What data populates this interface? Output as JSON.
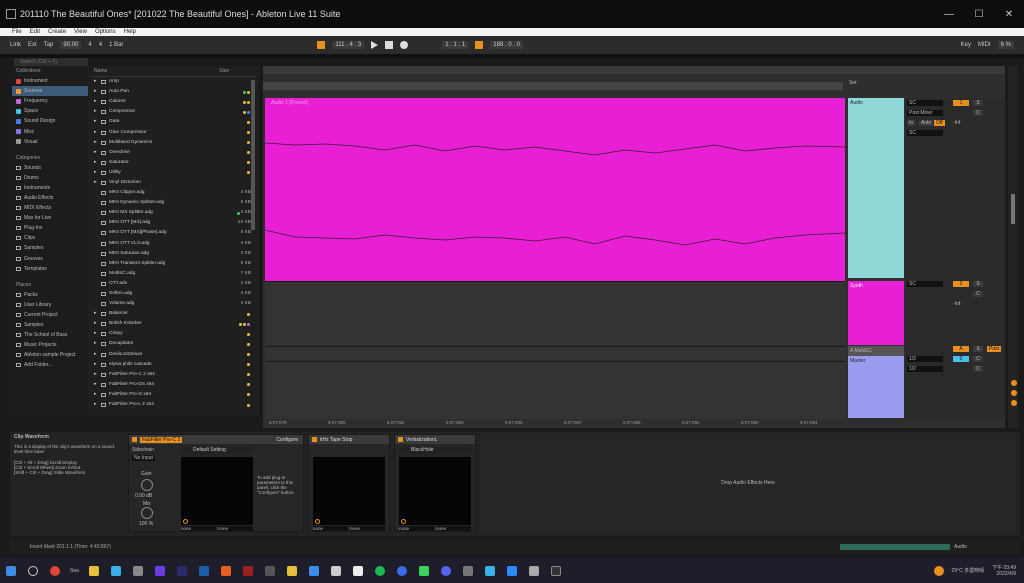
{
  "window": {
    "title": "201110 The Beautiful Ones* [201022 The Beautiful Ones] - Ableton Live 11 Suite",
    "controls": [
      "—",
      "☐",
      "✕"
    ]
  },
  "menu": [
    "File",
    "Edit",
    "Create",
    "View",
    "Options",
    "Help"
  ],
  "transport": {
    "link": "Link",
    "ext": "Ext",
    "tap": "Tap",
    "tempo": "90.00",
    "sig_num": "4",
    "sig_den": "4",
    "quant": "1 Bar",
    "position": "111 . 4 . 3",
    "loop_start": "1 . 1 . 1",
    "loop_len": "188 . 0 . 0",
    "key": "Key",
    "midi": "MIDI",
    "cpu": "6 %"
  },
  "browser": {
    "search_placeholder": "Search (Ctrl + F)",
    "collections_label": "Collections",
    "collections": [
      {
        "label": "Instrument",
        "color": "#e04444"
      },
      {
        "label": "Sources",
        "color": "#f29b2a"
      },
      {
        "label": "Frequency",
        "color": "#c764e0"
      },
      {
        "label": "Space",
        "color": "#46c0e8"
      },
      {
        "label": "Sound Design",
        "color": "#4a7be6"
      },
      {
        "label": "Misc",
        "color": "#8b6fe6"
      },
      {
        "label": "Visual",
        "color": "#999999"
      }
    ],
    "categories_label": "Categories",
    "categories": [
      "Sounds",
      "Drums",
      "Instruments",
      "Audio Effects",
      "MIDI Effects",
      "Max for Live",
      "Plug-Ins",
      "Clips",
      "Samples",
      "Grooves",
      "Templates"
    ],
    "places_label": "Places",
    "places": [
      "Packs",
      "User Library",
      "Current Project",
      "Samples",
      "The School of Bass",
      "Music Projects",
      "Ableton sample Project",
      "Add Folder..."
    ],
    "col_name": "Name",
    "col_size": "Size",
    "items": [
      {
        "name": "Amp",
        "size": "",
        "tags": []
      },
      {
        "name": "Auto Pan",
        "size": "",
        "tags": [
          "#3bd15a",
          "#e8c13a"
        ]
      },
      {
        "name": "Cabinet",
        "size": "",
        "tags": [
          "#e8c13a",
          "#e8c13a"
        ]
      },
      {
        "name": "Compressor",
        "size": "",
        "tags": [
          "#e8c13a",
          "#3b8de8"
        ]
      },
      {
        "name": "Gate",
        "size": "",
        "tags": [
          "#e8c13a"
        ]
      },
      {
        "name": "Glue Compressor",
        "size": "",
        "tags": [
          "#e8c13a"
        ]
      },
      {
        "name": "Multiband Dynamics",
        "size": "",
        "tags": [
          "#e8c13a"
        ]
      },
      {
        "name": "Overdrive",
        "size": "",
        "tags": [
          "#e8c13a"
        ]
      },
      {
        "name": "Saturator",
        "size": "",
        "tags": [
          "#e8c13a"
        ]
      },
      {
        "name": "Utility",
        "size": "",
        "tags": [
          "#e8c13a"
        ]
      },
      {
        "name": "Vinyl Distortion",
        "size": "",
        "tags": []
      },
      {
        "name": "MKII Clipper.adg",
        "size": "3 KB",
        "tags": []
      },
      {
        "name": "MKII Dynamic Splitter.adg",
        "size": "5 KB",
        "tags": []
      },
      {
        "name": "MKII MS Splitter.adg",
        "size": "3 KB",
        "tags": [
          "#3bd15a"
        ]
      },
      {
        "name": "MKII OTT [MS].adg",
        "size": "22 KB",
        "tags": []
      },
      {
        "name": "MKII OTT [MS][Phase].adg",
        "size": "6 KB",
        "tags": []
      },
      {
        "name": "MKII OTT v1.0.adg",
        "size": "4 KB",
        "tags": []
      },
      {
        "name": "MKII Saturator.adg",
        "size": "3 KB",
        "tags": []
      },
      {
        "name": "MKII Transient Splitter.adg",
        "size": "6 KB",
        "tags": []
      },
      {
        "name": "MultiSC.adg",
        "size": "7 KB",
        "tags": []
      },
      {
        "name": "OTT.adv",
        "size": "2 KB",
        "tags": []
      },
      {
        "name": "Soften.adg",
        "size": "4 KB",
        "tags": []
      },
      {
        "name": "Volume.adg",
        "size": "3 KB",
        "tags": []
      },
      {
        "name": "Balancer",
        "size": "",
        "tags": [
          "#e8c13a"
        ]
      },
      {
        "name": "British Kolorber",
        "size": "",
        "tags": [
          "#e8c13a",
          "#e8c13a",
          "#c764e0"
        ]
      },
      {
        "name": "Crispy",
        "size": "",
        "tags": [
          "#e8c13a"
        ]
      },
      {
        "name": "Decapitator",
        "size": "",
        "tags": [
          "#e8c13a"
        ]
      },
      {
        "name": "DevilLocDeluxe",
        "size": "",
        "tags": [
          "#e8c13a"
        ]
      },
      {
        "name": "elysia phils cascade",
        "size": "",
        "tags": [
          "#e8c13a"
        ]
      },
      {
        "name": "FabFilter Pro-C 2 x64",
        "size": "",
        "tags": [
          "#e8c13a"
        ]
      },
      {
        "name": "FabFilter Pro-DS x64",
        "size": "",
        "tags": [
          "#e8c13a"
        ]
      },
      {
        "name": "FabFilter Pro-G x64",
        "size": "",
        "tags": [
          "#e8c13a"
        ]
      },
      {
        "name": "FabFilter Pro-L 2 x64",
        "size": "",
        "tags": [
          "#e8c13a"
        ]
      }
    ]
  },
  "arrangement": {
    "clip_title": "Audio 1 [Frozen]",
    "set_label": "Set",
    "ruler": [
      "5:07:078",
      "5:07:080",
      "5:07:082",
      "5:07:083",
      "5:07:085",
      "5:07:087",
      "5:07:089",
      "5:07:090",
      "5:07:092",
      "5:07:094"
    ],
    "tracks": [
      {
        "name": "Audio",
        "color": "#8fd8d8",
        "in": "SC",
        "route": "Post Mixer",
        "auto": "In",
        "auto2": "Auto",
        "off": "Off",
        "num": "1",
        "S": "S",
        "C": "C",
        "inf": "-Inf"
      },
      {
        "name": "Synth",
        "color": "#e81fd4",
        "in": "SC",
        "num": "2",
        "S": "S",
        "C": "C",
        "inf": "-Inf"
      },
      {
        "name": "A MultiSC",
        "color": "#555555",
        "num": "A",
        "S": "S",
        "C": "C",
        "pre": "Post"
      },
      {
        "name": "Master",
        "color": "#9b9cf0",
        "r1": "1/2",
        "r2": "1/2",
        "num": "0",
        "C": "C"
      }
    ]
  },
  "clip_view": {
    "info_title": "Clip Waveform",
    "info_text": "This is a display of the clip's waveform on a sound-level time base",
    "info_lines": [
      "[Ctrl + Alt + Drag] Scroll Display",
      "[Ctrl + Scroll Wheel] Zoom In/Out",
      "[Shift + Ctrl + Drag] Slide Waveform"
    ]
  },
  "devices": [
    {
      "title": "FabFilter Pro-C 2",
      "sidechain": "Sidechain",
      "no_input": "No Input",
      "gain_label": "Gain",
      "gain_val": "0.00 dB",
      "mix_label": "Mix",
      "mix_val": "100 %",
      "preset": "Default Setting",
      "configure": "Configure",
      "hint": "To add plug-in parameters to this panel, click the \"Configure\" button.",
      "f1": "none",
      "f2": "none"
    },
    {
      "title": "kHz Tape Stop",
      "f1": "none",
      "f2": "none"
    },
    {
      "title": "VerbalizationL",
      "sub": "BlackHole",
      "f1": "none",
      "f2": "none"
    }
  ],
  "drop_text": "Drop Audio Effects Here",
  "status_text": "Insert Mark 201:1:1 (Time: 4:43:867)",
  "audio_label": "Audio",
  "taskbar": {
    "search": "Sea",
    "weather": "29°C 多雲時晴",
    "time": "下午 03:49",
    "date": "2022/4/9"
  }
}
